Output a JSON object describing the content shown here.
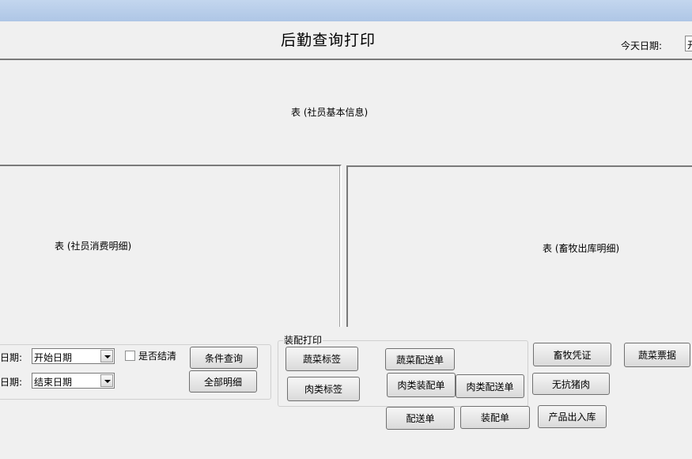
{
  "header": {
    "title": "后勤查询打印",
    "today_label": "今天日期:",
    "today_value": "开"
  },
  "panels": {
    "member_info": "表 (社员基本信息)",
    "member_consumption": "表 (社员消费明细)",
    "livestock_outbound": "表 (畜牧出库明细)"
  },
  "query": {
    "start_label": "日期:",
    "start_value": "开始日期",
    "end_label": "日期:",
    "end_value": "结束日期",
    "settled_label": "是否结清",
    "conditional_query": "条件查询",
    "all_details": "全部明细"
  },
  "packing": {
    "legend": "装配打印",
    "veg_label": "蔬菜标签",
    "meat_label": "肉类标签",
    "veg_delivery": "蔬菜配送单",
    "meat_packing": "肉类装配单",
    "meat_delivery": "肉类配送单"
  },
  "actions": {
    "livestock_voucher": "畜牧凭证",
    "veg_receipt": "蔬菜票据",
    "antibiotic_free_pork": "无抗猪肉",
    "delivery_note": "配送单",
    "packing_note": "装配单",
    "product_in_out": "产品出入库"
  }
}
